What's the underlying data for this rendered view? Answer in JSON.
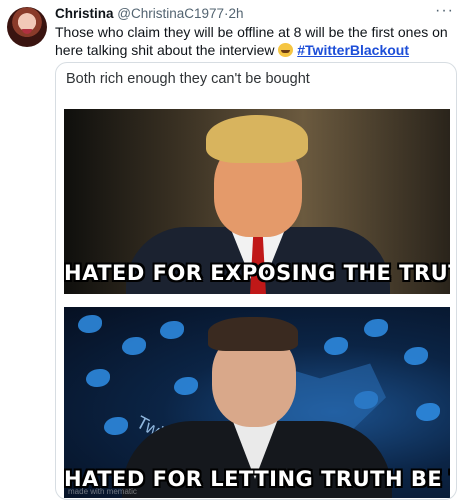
{
  "tweet": {
    "display_name": "Christina",
    "handle": "@ChristinaC1977",
    "separator": "·",
    "time": "2h",
    "more": "···",
    "text_before": "Those who claim they will be offline at 8 will be the first ones on here talking shit about the interview ",
    "hashtag": "#TwitterBlackout"
  },
  "media": {
    "caption": "Both rich enough they can't be bought",
    "top_text": "HATED FOR EXPOSING THE TRUTH",
    "bottom_text": "HATED FOR LETTING TRUTH BE TOLD",
    "background_text": "Twi",
    "watermark": "made with mematic"
  }
}
